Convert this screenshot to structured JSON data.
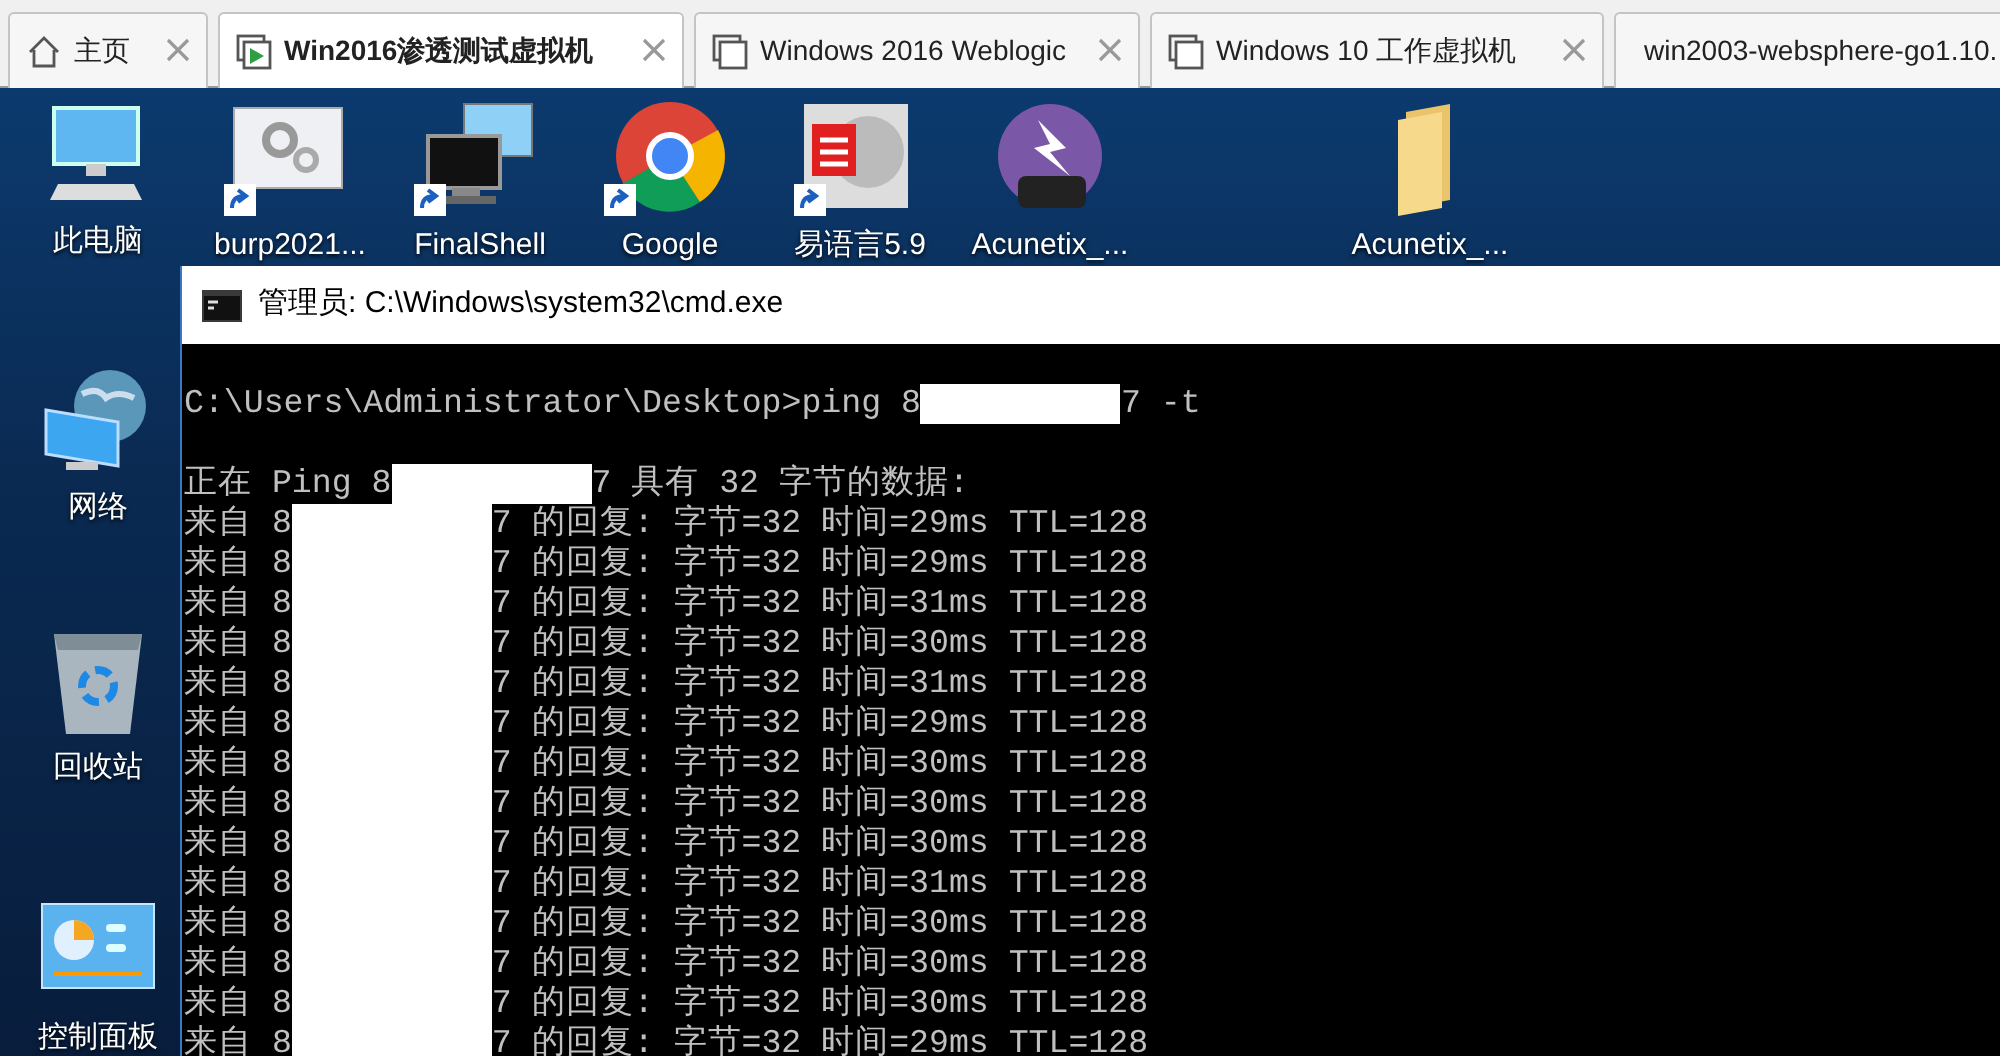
{
  "tabs": [
    {
      "label": "主页",
      "kind": "home",
      "selected": false
    },
    {
      "label": "Win2016渗透测试虚拟机",
      "kind": "running",
      "selected": true
    },
    {
      "label": "Windows 2016 Weblogic",
      "kind": "machine",
      "selected": false
    },
    {
      "label": "Windows 10 工作虚拟机",
      "kind": "machine",
      "selected": false
    },
    {
      "label": "win2003-websphere-go1.10.",
      "kind": "machine",
      "selected": false
    }
  ],
  "desktop_icons": [
    {
      "label": "此电脑",
      "kind": "computer",
      "shortcut": false
    },
    {
      "label": "burp2021...",
      "kind": "gears",
      "shortcut": true
    },
    {
      "label": "FinalShell",
      "kind": "monitors",
      "shortcut": true
    },
    {
      "label": "Google",
      "kind": "chrome",
      "shortcut": true
    },
    {
      "label": "易语言5.9",
      "kind": "easylang",
      "shortcut": true
    },
    {
      "label": "Acunetix_...",
      "kind": "rar",
      "shortcut": false
    },
    {
      "label": "Acunetix_...",
      "kind": "folder",
      "shortcut": false
    },
    {
      "label": "网络",
      "kind": "network",
      "shortcut": false
    },
    {
      "label": "回收站",
      "kind": "recycle",
      "shortcut": false
    },
    {
      "label": "控制面板",
      "kind": "control",
      "shortcut": false
    }
  ],
  "cmd_window": {
    "title": "管理员: C:\\Windows\\system32\\cmd.exe",
    "lines": [
      {
        "kind": "command",
        "before": "C:\\Users\\Administrator\\Desktop>ping 8",
        "after": "7 -t"
      },
      {
        "kind": "blank"
      },
      {
        "kind": "output",
        "before": "正在 Ping 8",
        "after": "7 具有 32 字节的数据:"
      },
      {
        "kind": "output",
        "before": "来自 8",
        "after": "7 的回复: 字节=32 时间=29ms TTL=128"
      },
      {
        "kind": "output",
        "before": "来自 8",
        "after": "7 的回复: 字节=32 时间=29ms TTL=128"
      },
      {
        "kind": "output",
        "before": "来自 8",
        "after": "7 的回复: 字节=32 时间=31ms TTL=128"
      },
      {
        "kind": "output",
        "before": "来自 8",
        "after": "7 的回复: 字节=32 时间=30ms TTL=128"
      },
      {
        "kind": "output",
        "before": "来自 8",
        "after": "7 的回复: 字节=32 时间=31ms TTL=128"
      },
      {
        "kind": "output",
        "before": "来自 8",
        "after": "7 的回复: 字节=32 时间=29ms TTL=128"
      },
      {
        "kind": "output",
        "before": "来自 8",
        "after": "7 的回复: 字节=32 时间=30ms TTL=128"
      },
      {
        "kind": "output",
        "before": "来自 8",
        "after": "7 的回复: 字节=32 时间=30ms TTL=128"
      },
      {
        "kind": "output",
        "before": "来自 8",
        "after": "7 的回复: 字节=32 时间=30ms TTL=128"
      },
      {
        "kind": "output",
        "before": "来自 8",
        "after": "7 的回复: 字节=32 时间=31ms TTL=128"
      },
      {
        "kind": "output",
        "before": "来自 8",
        "after": "7 的回复: 字节=32 时间=30ms TTL=128"
      },
      {
        "kind": "output",
        "before": "来自 8",
        "after": "7 的回复: 字节=32 时间=30ms TTL=128"
      },
      {
        "kind": "output",
        "before": "来自 8",
        "after": "7 的回复: 字节=32 时间=30ms TTL=128"
      },
      {
        "kind": "output",
        "before": "来自 8",
        "after": "7 的回复: 字节=32 时间=29ms TTL=128"
      }
    ]
  }
}
